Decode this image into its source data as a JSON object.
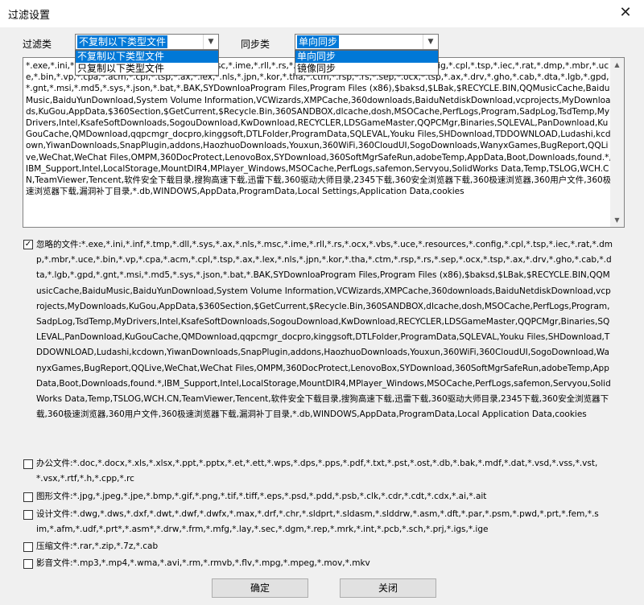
{
  "window": {
    "title": "过滤设置"
  },
  "filter_type": {
    "label": "过滤类",
    "selected": "不复制以下类型文件",
    "options": [
      "不复制以下类型文件",
      "只复制以下类型文件"
    ]
  },
  "sync_type": {
    "label": "同步类",
    "selected": "单向同步",
    "options": [
      "单向同步",
      "镜像同步"
    ]
  },
  "filter_text": "*.exe,*.ini,*.inf,*.tmp,*.dll,*.sys,*.ax,*.nls,*.msc,*.ime,*.rll,*.rs,*.ocx,*.vbs,*.uce,*.resources,*.config,*.cpl,*.tsp,*.iec,*.rat,*.dmp,*.mbr,*.uce,*.bin,*.vp,*.cpa,*.acm,*.cpl,*.tsp,*.ax,*.lex,*.nls,*.jpn,*.kor,*.tha,*.ctm,*.rsp,*.rs,*.sep,*.ocx,*.tsp,*.ax,*.drv,*.gho,*.cab,*.dta,*.lgb,*.gpd,*.gnt,*.msi,*.md5,*.sys,*.json,*.bat,*.BAK,SYDownloaProgram Files,Program Files (x86),$baksd,$LBak,$RECYCLE.BIN,QQMusicCache,BaiduMusic,BaiduYunDownload,System Volume Information,VCWizards,XMPCache,360downloads,BaiduNetdiskDownload,vcprojects,MyDownloads,KuGou,AppData,$360Section,$GetCurrent,$Recycle.Bin,360SANDBOX,dlcache,dosh,MSOCache,PerfLogs,Program,SadpLog,TsdTemp,MyDrivers,Intel,KsafeSoftDownloads,SogouDownload,KwDownload,RECYCLER,LDSGameMaster,QQPCMgr,Binaries,SQLEVAL,PanDownload,KuGouCache,QMDownload,qqpcmgr_docpro,kinggsoft,DTLFolder,ProgramData,SQLEVAL,Youku Files,SHDownload,TDDOWNLOAD,Ludashi,kcdown,YiwanDownloads,SnapPlugin,addons,HaozhuoDownloads,Youxun,360WiFi,360CloudUI,SogoDownloads,WanyxGames,BugReport,QQLive,WeChat,WeChat Files,OMPM,360DocProtect,LenovoBox,SYDownload,360SoftMgrSafeRun,adobeTemp,AppData,Boot,Downloads,found.*,IBM_Support,Intel,LocalStorage,MountDIR4,MPlayer_Windows,MSOCache,PerfLogs,safemon,Servyou,SolidWorks Data,Temp,TSLOG,WCH.CN,TeamViewer,Tencent,软件安全下载目录,搜狗高速下载,迅雷下载,360驱动大师目录,2345下载,360安全浏览器下载,360极速浏览器,360用户文件,360极速浏览器下载,漏洞补丁目录,*.db,WINDOWS,AppData,ProgramData,Local Settings,Application Data,cookies",
  "ignored": {
    "checked": true,
    "label": "忽略的文件:",
    "text": "*.exe,*.ini,*.inf,*.tmp,*.dll,*.sys,*.ax,*.nls,*.msc,*.ime,*.rll,*.rs,*.ocx,*.vbs,*.uce,*.resources,*.config,*.cpl,*.tsp,*.iec,*.rat,*.dmp,*.mbr,*.uce,*.bin,*.vp,*.cpa,*.acm,*.cpl,*.tsp,*.ax,*.lex,*.nls,*.jpn,*.kor,*.tha,*.ctm,*.rsp,*.rs,*.sep,*.ocx,*.tsp,*.ax,*.drv,*.gho,*.cab,*.dta,*.lgb,*.gpd,*.gnt,*.msi,*.md5,*.sys,*.json,*.bat,*.BAK,SYDownloaProgram Files,Program Files (x86),$baksd,$LBak,$RECYCLE.BIN,QQMusicCache,BaiduMusic,BaiduYunDownload,System Volume Information,VCWizards,XMPCache,360downloads,BaiduNetdiskDownload,vcprojects,MyDownloads,KuGou,AppData,$360Section,$GetCurrent,$Recycle.Bin,360SANDBOX,dlcache,dosh,MSOCache,PerfLogs,Program,SadpLog,TsdTemp,MyDrivers,Intel,KsafeSoftDownloads,SogouDownload,KwDownload,RECYCLER,LDSGameMaster,QQPCMgr,Binaries,SQLEVAL,PanDownload,KuGouCache,QMDownload,qqpcmgr_docpro,kinggsoft,DTLFolder,ProgramData,SQLEVAL,Youku Files,SHDownload,TDDOWNLOAD,Ludashi,kcdown,YiwanDownloads,SnapPlugin,addons,HaozhuoDownloads,Youxun,360WiFi,360CloudUI,SogoDownload,WanyxGames,BugReport,QQLive,WeChat,WeChat Files,OMPM,360DocProtect,LenovoBox,SYDownload,360SoftMgrSafeRun,adobeTemp,AppData,Boot,Downloads,found.*,IBM_Support,Intel,LocalStorage,MountDIR4,MPlayer_Windows,MSOCache,PerfLogs,safemon,Servyou,SolidWorks Data,Temp,TSLOG,WCH.CN,TeamViewer,Tencent,软件安全下载目录,搜狗高速下载,迅雷下载,360驱动大师目录,2345下载,360安全浏览器下载,360极速浏览器,360用户文件,360极速浏览器下载,漏洞补丁目录,*.db,WINDOWS,AppData,ProgramData,Local Application Data,cookies"
  },
  "categories": [
    {
      "checked": false,
      "label": "办公文件:",
      "text": "*.doc,*.docx,*.xls,*.xlsx,*.ppt,*.pptx,*.et,*.ett,*.wps,*.dps,*.pps,*.pdf,*.txt,*.pst,*.ost,*.db,*.bak,*.mdf,*.dat,*.vsd,*.vss,*.vst,*.vsx,*.rtf,*.h,*.cpp,*.rc"
    },
    {
      "checked": false,
      "label": "图形文件:",
      "text": "*.jpg,*.jpeg,*.jpe,*.bmp,*.gif,*.png,*.tif,*.tiff,*.eps,*.psd,*.pdd,*.psb,*.clk,*.cdr,*.cdt,*.cdx,*.ai,*.ait"
    },
    {
      "checked": false,
      "label": "设计文件:",
      "text": "*.dwg,*.dws,*.dxf,*.dwt,*.dwf,*.dwfx,*.max,*.drf,*.chr,*.sldprt,*.sldasm,*.slddrw,*.asm,*.dft,*.par,*.psm,*.pwd,*.prt,*.fem,*.sim,*.afm,*.udf,*.prt*,*.asm*,*.drw,*.frm,*.mfg,*.lay,*.sec,*.dgm,*.rep,*.mrk,*.int,*.pcb,*.sch,*.prj,*.igs,*.ige"
    },
    {
      "checked": false,
      "label": "压缩文件:",
      "text": "*.rar,*.zip,*.7z,*.cab"
    },
    {
      "checked": false,
      "label": "影音文件:",
      "text": "*.mp3,*.mp4,*.wma,*.avi,*.rm,*.rmvb,*.flv,*.mpg,*.mpeg,*.mov,*.mkv"
    }
  ],
  "buttons": {
    "ok": "确定",
    "close": "关闭"
  },
  "icons": {
    "close": "close-icon",
    "dropdown": "chevron-down-icon",
    "checkbox": "check-icon"
  }
}
